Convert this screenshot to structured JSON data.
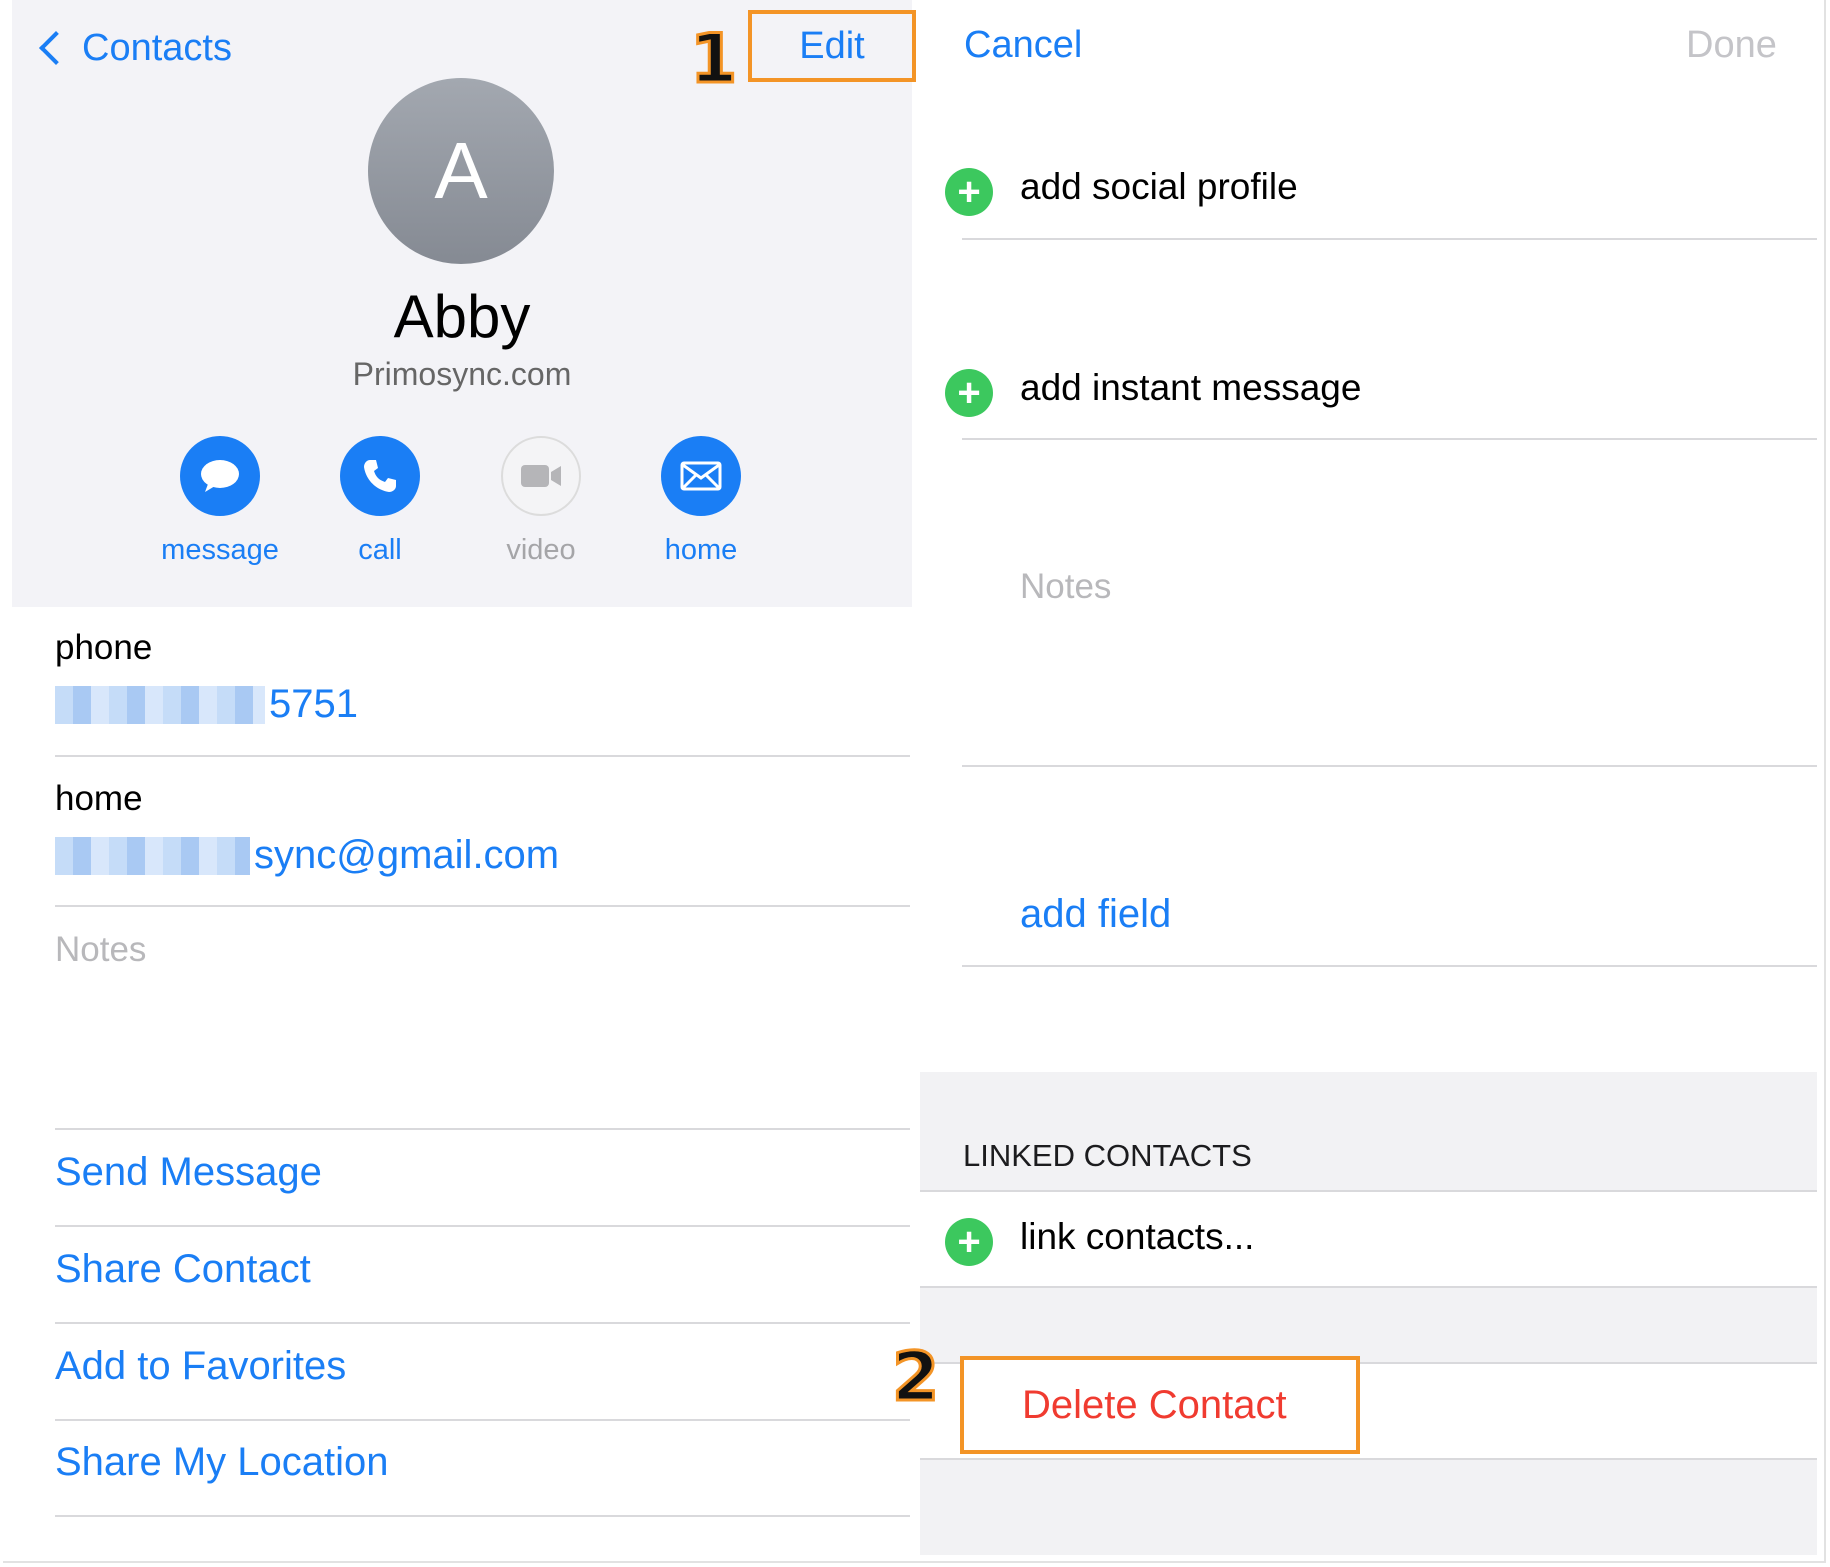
{
  "left": {
    "nav": {
      "back_label": "Contacts",
      "edit_label": "Edit"
    },
    "step1": "1",
    "avatar_initial": "A",
    "name": "Abby",
    "company": "Primosync.com",
    "actions": [
      {
        "label": "message",
        "icon": "message-bubble-icon",
        "enabled": true
      },
      {
        "label": "call",
        "icon": "phone-icon",
        "enabled": true
      },
      {
        "label": "video",
        "icon": "video-camera-icon",
        "enabled": false
      },
      {
        "label": "home",
        "icon": "mail-envelope-icon",
        "enabled": true
      }
    ],
    "phone": {
      "label": "phone",
      "value_visible": "5751"
    },
    "email": {
      "label": "home",
      "value_visible": "sync@gmail.com"
    },
    "notes_placeholder": "Notes",
    "links": [
      "Send Message",
      "Share Contact",
      "Add to Favorites",
      "Share My Location"
    ]
  },
  "right": {
    "nav": {
      "cancel_label": "Cancel",
      "done_label": "Done"
    },
    "add_social_profile": "add social profile",
    "add_instant_message": "add instant message",
    "notes_placeholder": "Notes",
    "add_field": "add field",
    "linked_contacts_title": "LINKED CONTACTS",
    "link_contacts": "link contacts...",
    "step2": "2",
    "delete_contact": "Delete Contact"
  },
  "colors": {
    "accent_blue": "#1a7ef5",
    "highlight_orange": "#f39426",
    "add_green": "#3cc85e",
    "destructive_red": "#f03b30"
  }
}
